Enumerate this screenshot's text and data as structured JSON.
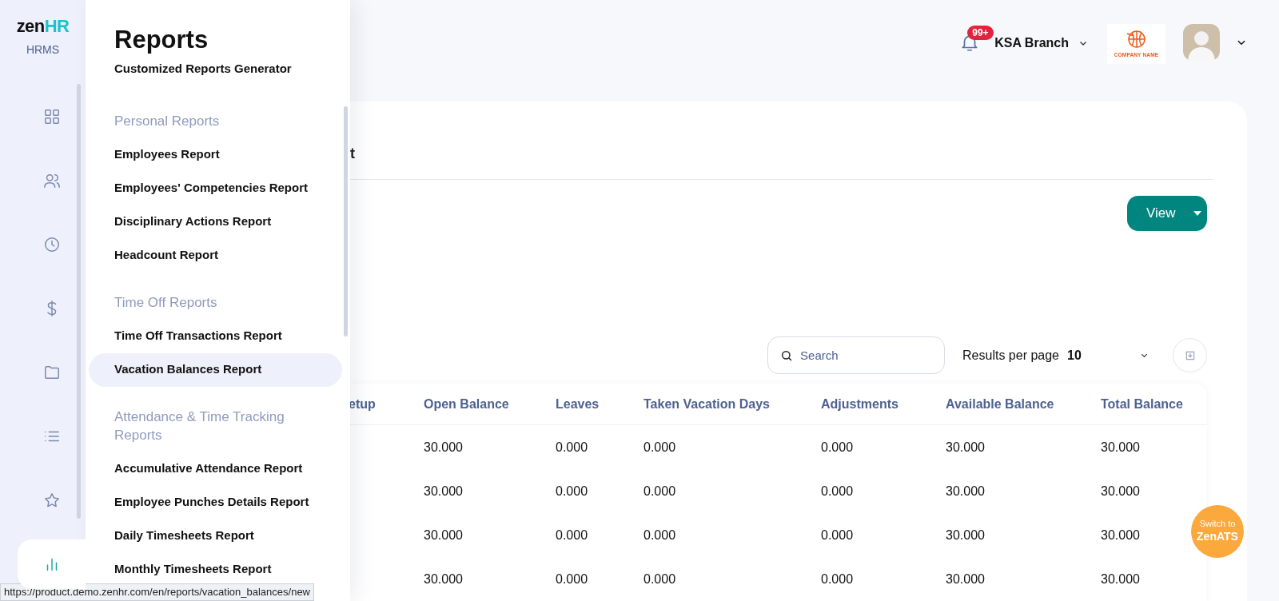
{
  "rail": {
    "logo": {
      "word": "zen",
      "accent": "HR"
    },
    "product": "HRMS",
    "items": [
      {
        "selected": false
      },
      {
        "selected": false
      },
      {
        "selected": false
      },
      {
        "selected": false
      },
      {
        "selected": false
      },
      {
        "selected": false
      },
      {
        "selected": false
      },
      {
        "selected": true
      }
    ]
  },
  "panel": {
    "title": "Reports",
    "subtitle": "Customized Reports Generator",
    "sections": [
      {
        "heading": "Personal Reports",
        "items": [
          {
            "label": "Employees Report",
            "selected": false
          },
          {
            "label": "Employees' Competencies Report",
            "selected": false
          },
          {
            "label": "Disciplinary Actions Report",
            "selected": false
          },
          {
            "label": "Headcount Report",
            "selected": false
          }
        ]
      },
      {
        "heading": "Time Off Reports",
        "items": [
          {
            "label": "Time Off Transactions Report",
            "selected": false
          },
          {
            "label": "Vacation Balances Report",
            "selected": true
          }
        ]
      },
      {
        "heading": "Attendance & Time Tracking Reports",
        "items": [
          {
            "label": "Accumulative Attendance Report",
            "selected": false
          },
          {
            "label": "Employee Punches Details Report",
            "selected": false
          },
          {
            "label": "Daily Timesheets Report",
            "selected": false
          },
          {
            "label": "Monthly Timesheets Report",
            "selected": false
          }
        ]
      }
    ]
  },
  "header": {
    "notification_badge": "99+",
    "branch": "KSA Branch",
    "company_logo_text": "COMPANY NAME"
  },
  "report": {
    "tab_label": "t",
    "view_button": "View",
    "search": {
      "placeholder": "Search"
    },
    "results_per_page": {
      "label": "Results per page",
      "value": "10"
    },
    "table": {
      "columns": [
        "etup",
        "Open Balance",
        "Leaves",
        "Taken Vacation Days",
        "Adjustments",
        "Available Balance",
        "Total Balance"
      ],
      "rows": [
        [
          "",
          "30.000",
          "0.000",
          "0.000",
          "0.000",
          "30.000",
          "30.000"
        ],
        [
          "",
          "30.000",
          "0.000",
          "0.000",
          "0.000",
          "30.000",
          "30.000"
        ],
        [
          "",
          "30.000",
          "0.000",
          "0.000",
          "0.000",
          "30.000",
          "30.000"
        ],
        [
          "",
          "30.000",
          "0.000",
          "0.000",
          "0.000",
          "30.000",
          "30.000"
        ]
      ]
    }
  },
  "switch_button": {
    "line1": "Switch to",
    "line2": "ZenATS"
  },
  "status_url": "https://product.demo.zenhr.com/en/reports/vacation_balances/new"
}
